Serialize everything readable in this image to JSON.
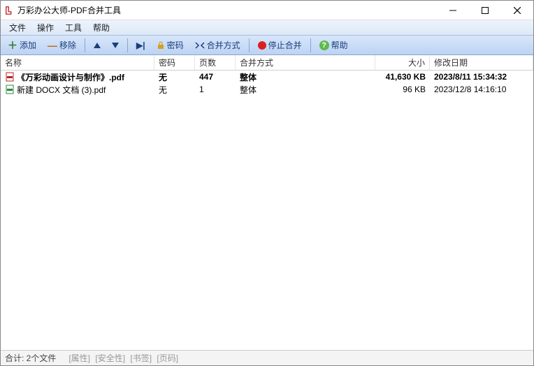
{
  "window": {
    "title": "万彩办公大师-PDF合并工具"
  },
  "menu": {
    "file": "文件",
    "operate": "操作",
    "tools": "工具",
    "help": "帮助"
  },
  "toolbar": {
    "add": "添加",
    "remove": "移除",
    "password": "密码",
    "merge_mode": "合并方式",
    "stop_merge": "停止合并",
    "help": "帮助"
  },
  "columns": {
    "name": "名称",
    "password": "密码",
    "pages": "页数",
    "merge_mode": "合并方式",
    "size": "大小",
    "modified": "修改日期"
  },
  "files": [
    {
      "name": "《万彩动画设计与制作》.pdf",
      "password": "无",
      "pages": "447",
      "mode": "整体",
      "size": "41,630 KB",
      "modified": "2023/8/11 15:34:32",
      "bold": true
    },
    {
      "name": "新建 DOCX 文档 (3).pdf",
      "password": "无",
      "pages": "1",
      "mode": "整体",
      "size": "96 KB",
      "modified": "2023/12/8 14:16:10",
      "bold": false
    }
  ],
  "status": {
    "count": "合计: 2个文件",
    "tabs": {
      "props": "[属性]",
      "security": "[安全性]",
      "bookmark": "[书签]",
      "pagenum": "[页码]"
    }
  }
}
